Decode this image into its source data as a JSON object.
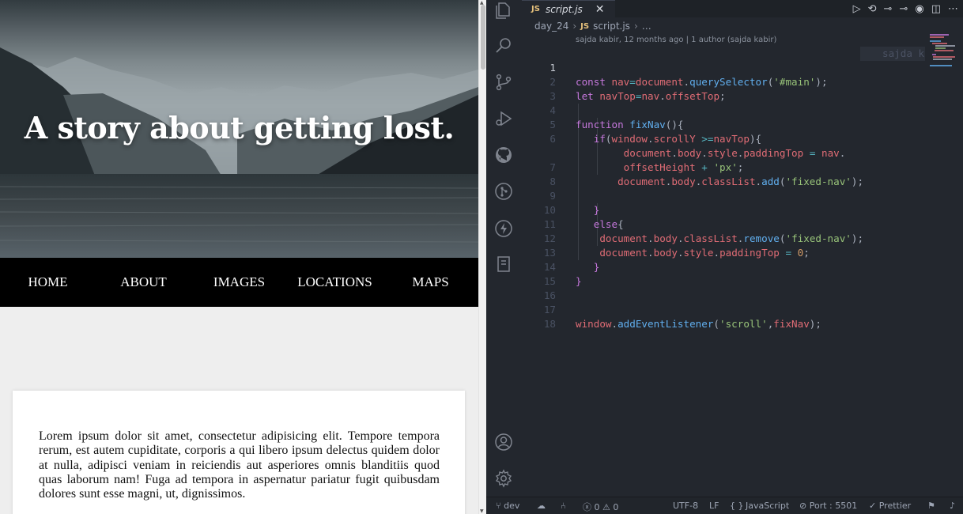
{
  "preview": {
    "hero_title": "A story about getting lost.",
    "nav_items": [
      "HOME",
      "ABOUT",
      "IMAGES",
      "LOCATIONS",
      "MAPS"
    ],
    "paragraph": "Lorem ipsum dolor sit amet, consectetur adipisicing elit. Tempore tempora rerum, est autem cupiditate, corporis a qui libero ipsum delectus quidem dolor at nulla, adipisci veniam in reiciendis aut asperiores omnis blanditiis quod quas laborum nam! Fuga ad tempora in aspernatur pariatur fugit quibusdam dolores sunt esse magni, ut, dignissimos."
  },
  "editor": {
    "tab": {
      "badge": "JS",
      "filename": "script.js",
      "close": "✕"
    },
    "breadcrumb": {
      "folder": "day_24",
      "sep": "›",
      "badge": "JS",
      "file": "script.js",
      "sep2": "›",
      "rest": "…"
    },
    "blame_header": "sajda kabir, 12 months ago | 1 author (sajda kabir)",
    "inline_blame": "sajda k",
    "line_numbers": [
      "1",
      "2",
      "3",
      "4",
      "5",
      "6",
      "",
      "7",
      "8",
      "9",
      "10",
      "11",
      "12",
      "13",
      "14",
      "15",
      "16",
      "17",
      "18"
    ],
    "active_line": "1"
  },
  "status_bar": {
    "branch": "dev",
    "errors": "0",
    "warnings": "0",
    "encoding": "UTF-8",
    "eol": "LF",
    "braces": "{ }",
    "language": "JavaScript",
    "port": "Port : 5501",
    "prettier": "Prettier"
  },
  "icons": {
    "activity_bar": [
      "files-icon",
      "search-icon",
      "source-control-icon",
      "run-debug-icon",
      "github-icon",
      "git-graph-icon",
      "thunder-client-icon",
      "notebook-icon",
      "account-icon",
      "settings-gear-icon"
    ],
    "accent": "#61afef",
    "background": "#23272e"
  }
}
